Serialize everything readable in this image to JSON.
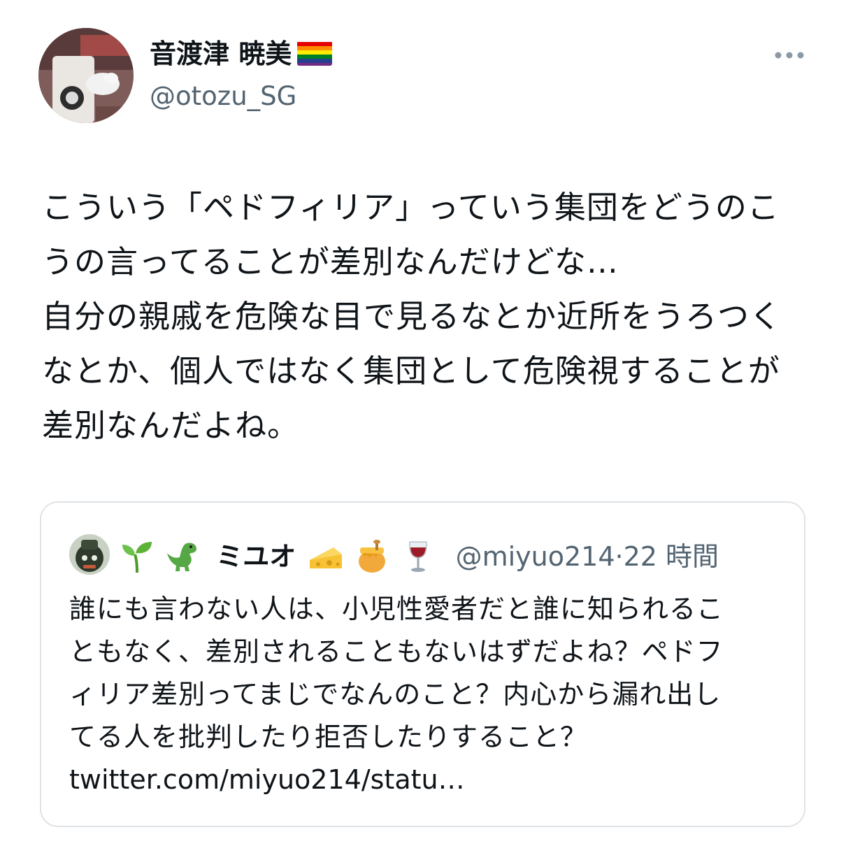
{
  "author": {
    "display_name": "音渡津 暁美",
    "handle": "@otozu_SG",
    "flag_icon": "rainbow-flag-icon"
  },
  "tweet": {
    "lines": [
      "こういう「ペドフィリア」っていう集団をどうのこ",
      "うの言ってることが差別なんだけどな…",
      "自分の親戚を危険な目で見るなとか近所をうろつく",
      "なとか、個人ではなく集団として危険視することが",
      "差別なんだよね。"
    ]
  },
  "quote": {
    "name": "ミユオ",
    "name_emojis_before": [
      "seedling-icon",
      "t-rex-icon"
    ],
    "name_emojis_after": [
      "cheese-icon",
      "honey-pot-icon",
      "wine-glass-icon"
    ],
    "handle": "@miyuo214",
    "separator": "·",
    "time": "22 時間",
    "lines": [
      "誰にも言わない人は、小児性愛者だと誰に知られるこ",
      "ともなく、差別されることもないはずだよね？ペドフ",
      "ィリア差別ってまじでなんのこと？内心から漏れ出し",
      "てる人を批判したり拒否したりすること？"
    ],
    "link": "twitter.com/miyuo214/statu…"
  },
  "colors": {
    "text": "#0f1419",
    "secondary": "#536471",
    "border": "#dfe3e6"
  }
}
